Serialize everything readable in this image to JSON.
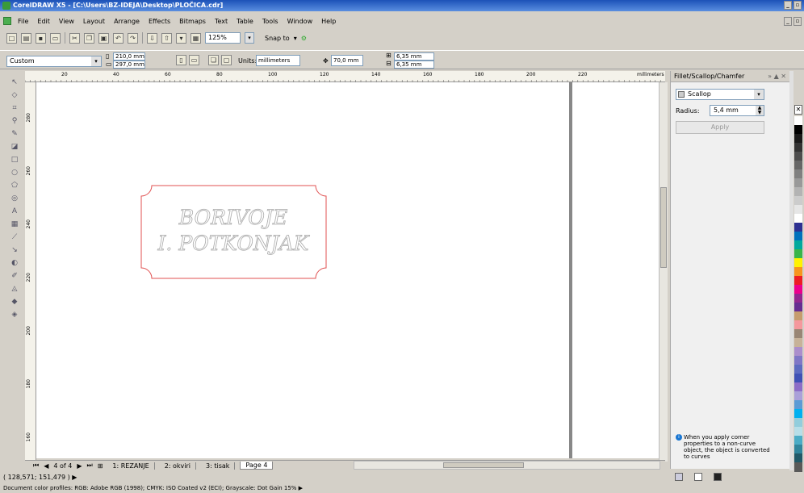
{
  "app": {
    "title": "CorelDRAW X5 - [C:\\Users\\BZ-IDEJA\\Desktop\\PLOČICA.cdr]"
  },
  "menu": [
    "File",
    "Edit",
    "View",
    "Layout",
    "Arrange",
    "Effects",
    "Bitmaps",
    "Text",
    "Table",
    "Tools",
    "Window",
    "Help"
  ],
  "toolbar": {
    "zoom": "125%",
    "snap_label": "Snap to"
  },
  "propbar": {
    "page_preset": "Custom",
    "width": "210,0 mm",
    "height": "297,0 mm",
    "units_label": "Units:",
    "units": "millimeters",
    "nudge": "70,0 mm",
    "dup_x": "6,35 mm",
    "dup_y": "6,35 mm"
  },
  "ruler": {
    "h_ticks": [
      "20",
      "40",
      "60",
      "80",
      "100",
      "120",
      "140",
      "160",
      "180",
      "200",
      "220"
    ],
    "h_unit": "millimeters",
    "v_ticks": [
      "280",
      "260",
      "240",
      "220",
      "200",
      "180",
      "160"
    ],
    "v_unit": "millimeters"
  },
  "canvas": {
    "line1": "BORIVOJE",
    "line2": "I. POTKONJAK",
    "text_color": "#aaaaaa",
    "frame_color": "#e05050"
  },
  "pages": {
    "counter": "4 of 4",
    "tabs": [
      "1: REZANJE",
      "2: okviri",
      "3: tisak",
      "Page 4"
    ],
    "active": "Page 4"
  },
  "status": {
    "coords": "( 128,571; 151,479 )",
    "profiles": "Document color profiles: RGB: Adobe RGB (1998); CMYK: ISO Coated v2 (ECI); Grayscale: Dot Gain 15%"
  },
  "docker": {
    "title": "Fillet/Scallop/Chamfer",
    "mode": "Scallop",
    "radius_label": "Radius:",
    "radius": "5,4 mm",
    "apply": "Apply",
    "note": "When you apply corner properties to a non-curve object, the object is converted to curves"
  },
  "palette": [
    "#ffffff",
    "#000000",
    "#1a1a1a",
    "#333333",
    "#4d4d4d",
    "#666666",
    "#808080",
    "#999999",
    "#b3b3b3",
    "#cccccc",
    "#e6e6e6",
    "#ffffff",
    "#2e3192",
    "#0071bc",
    "#00a99d",
    "#39b54a",
    "#fff200",
    "#f7941d",
    "#ed1c24",
    "#ec008c",
    "#92278f",
    "#662d91",
    "#c69c6d",
    "#f5989d",
    "#998675",
    "#c7b299",
    "#ab8ecc",
    "#7f77c6",
    "#5c6bc0",
    "#3f51b5",
    "#8c6dc7",
    "#aaa0d9",
    "#5b9bd5",
    "#00b0f0",
    "#92cddc",
    "#b7dee8",
    "#4bacc6",
    "#31859c",
    "#215968",
    "#595959"
  ]
}
